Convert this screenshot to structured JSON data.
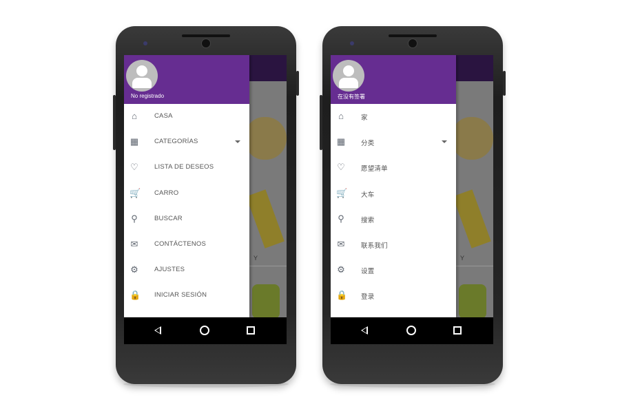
{
  "colors": {
    "drawer_header": "#662d91",
    "icon": "#5f6670",
    "appbar": "#2a1440"
  },
  "phones": [
    {
      "language": "es",
      "user_label": "No registrado",
      "partial_content_text": "Y",
      "items": [
        {
          "icon": "home-icon",
          "label": "CASA"
        },
        {
          "icon": "categories-icon",
          "label": "CATEGORÍAS",
          "expandable": true
        },
        {
          "icon": "heart-icon",
          "label": "LISTA DE DESEOS"
        },
        {
          "icon": "cart-icon",
          "label": "CARRO"
        },
        {
          "icon": "search-icon",
          "label": "BUSCAR"
        },
        {
          "icon": "mail-icon",
          "label": "CONTÁCTENOS"
        },
        {
          "icon": "gear-icon",
          "label": "AJUSTES"
        },
        {
          "icon": "lock-icon",
          "label": "INICIAR SESIÓN"
        }
      ]
    },
    {
      "language": "zh",
      "user_label": "在没有签署",
      "partial_content_text": "Y",
      "items": [
        {
          "icon": "home-icon",
          "label": "家"
        },
        {
          "icon": "categories-icon",
          "label": "分类",
          "expandable": true
        },
        {
          "icon": "heart-icon",
          "label": "愿望清单"
        },
        {
          "icon": "cart-icon",
          "label": "大车"
        },
        {
          "icon": "search-icon",
          "label": "搜索"
        },
        {
          "icon": "mail-icon",
          "label": "联系我们"
        },
        {
          "icon": "gear-icon",
          "label": "设置"
        },
        {
          "icon": "lock-icon",
          "label": "登录"
        }
      ]
    }
  ]
}
